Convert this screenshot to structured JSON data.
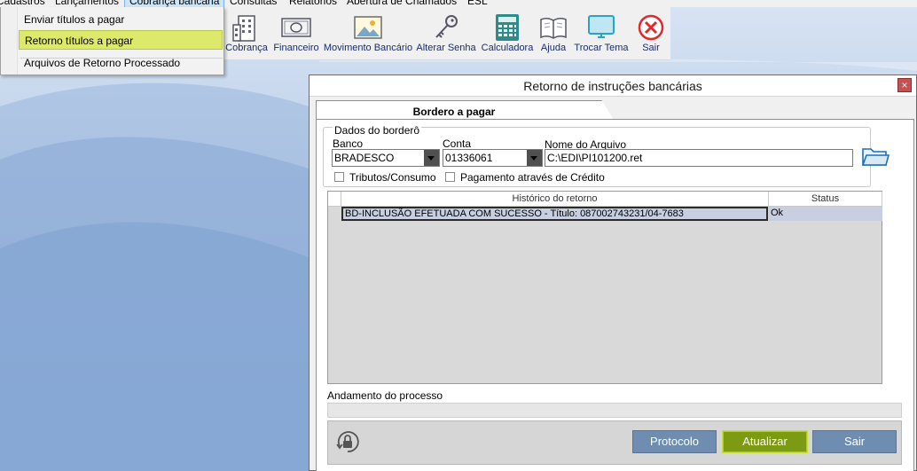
{
  "menubar": {
    "items": [
      "Cadastros",
      "Lançamentos",
      "Cobrança bancária",
      "Consultas",
      "Relatórios",
      "Abertura de Chamados",
      "ESL"
    ],
    "active_index": 2
  },
  "dropdown": {
    "items": [
      {
        "label": "Enviar títulos a pagar"
      },
      {
        "label": "Retorno títulos a pagar"
      },
      {
        "label": "Arquivos de Retorno Processado"
      }
    ],
    "highlighted_index": 1
  },
  "toolbar": {
    "buttons": [
      {
        "label": "Cobrança",
        "icon": "building-icon"
      },
      {
        "label": "Financeiro",
        "icon": "banknote-icon"
      },
      {
        "label": "Movimento Bancário",
        "icon": "picture-icon"
      },
      {
        "label": "Alterar Senha",
        "icon": "key-icon"
      },
      {
        "label": "Calculadora",
        "icon": "calculator-icon"
      },
      {
        "label": "Ajuda",
        "icon": "book-icon"
      },
      {
        "label": "Trocar Tema",
        "icon": "monitor-icon"
      },
      {
        "label": "Sair",
        "icon": "close-circle-icon"
      }
    ]
  },
  "dialog": {
    "title": "Retorno de instruções bancárias",
    "close_glyph": "×",
    "tab_label": "Bordero a pagar",
    "group_label": "Dados do borderô",
    "banco": {
      "label": "Banco",
      "value": "BRADESCO"
    },
    "conta": {
      "label": "Conta",
      "value": "01336061"
    },
    "arquivo": {
      "label": "Nome do Arquivo",
      "value": "C:\\EDI\\PI101200.ret"
    },
    "checkboxes": {
      "tributos": {
        "label": "Tributos/Consumo",
        "checked": false
      },
      "credito": {
        "label": "Pagamento através de Crédito",
        "checked": false
      }
    },
    "grid": {
      "columns": [
        "Histórico do retorno",
        "Status"
      ],
      "rows": [
        {
          "historico": "BD-INCLUSÃO EFETUADA COM SUCESSO - Título: 087002743231/04-7683",
          "status": "Ok"
        }
      ]
    },
    "progress_label": "Andamento do processo",
    "progress_value": 0,
    "buttons": {
      "protocolo": "Protocolo",
      "atualizar": "Atualizar",
      "sair": "Sair"
    }
  }
}
